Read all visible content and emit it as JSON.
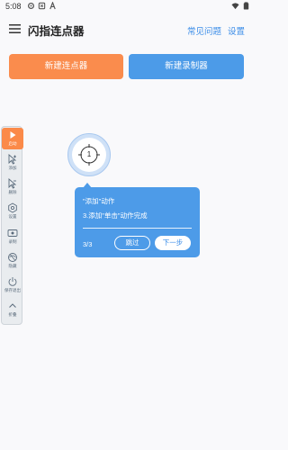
{
  "status_bar": {
    "time": "5:08",
    "icons": [
      "settings-icon",
      "shield-icon",
      "a-icon",
      "wifi-icon",
      "battery-icon"
    ]
  },
  "app_bar": {
    "title": "闪指连点器",
    "faq_label": "常见问题",
    "settings_label": "设置"
  },
  "actions": {
    "new_clicker_label": "新建连点器",
    "new_recorder_label": "新建录制器"
  },
  "toolbar": {
    "items": [
      {
        "label": "启动",
        "icon": "play-icon",
        "active": true
      },
      {
        "label": "添加",
        "icon": "pointer-add-icon",
        "active": false
      },
      {
        "label": "删除",
        "icon": "pointer-remove-icon",
        "active": false
      },
      {
        "label": "设置",
        "icon": "gear-icon",
        "active": false
      },
      {
        "label": "录制",
        "icon": "record-icon",
        "active": false
      },
      {
        "label": "隐藏",
        "icon": "hide-icon",
        "active": false
      },
      {
        "label": "保存退出",
        "icon": "power-icon",
        "active": false
      },
      {
        "label": "折叠",
        "icon": "collapse-icon",
        "active": false
      }
    ]
  },
  "target": {
    "number": "1"
  },
  "tutorial": {
    "title": "\"添加\"动作",
    "step_text": "3.添加\"单击\"动作完成",
    "counter": "3/3",
    "skip_label": "跳过",
    "next_label": "下一步"
  },
  "colors": {
    "orange": "#fa8c4d",
    "blue": "#4c9be8",
    "link": "#3b8de8",
    "background": "#f9f9fb"
  }
}
